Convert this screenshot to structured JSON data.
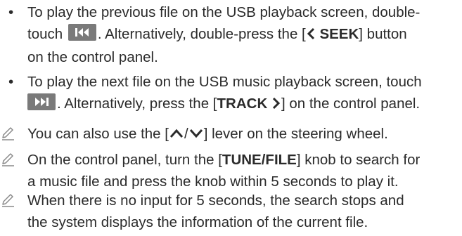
{
  "bullets": [
    {
      "part1": "To play the previous file on the USB playback screen, double-",
      "part2_before_icon": "touch",
      "icon": "skip-previous-icon",
      "part2_after_icon": ". Alternatively, double-press the [",
      "button_label": "SEEK",
      "part2_end": "] button",
      "part3": "on the control panel."
    },
    {
      "part1": "To play the next file on the USB music playback screen, touch",
      "icon": "skip-next-icon",
      "part2_after_icon": ". Alternatively, press the [",
      "button_label": "TRACK",
      "part2_end": "] on the control panel."
    }
  ],
  "notes": [
    {
      "icon": "pencil-note-icon",
      "before": "You can also use the [",
      "after": "] lever on the steering wheel."
    },
    {
      "icon": "pencil-note-icon",
      "line1_before": "On the control panel, turn the [",
      "knob_label": "TUNE/FILE",
      "line1_after": "] knob to search for",
      "line2": "a music file and press the knob within 5 seconds to play it."
    },
    {
      "icon": "pencil-note-icon",
      "line1": "When there is no input for 5 seconds, the search stops and",
      "line2": "the system displays the information of the current file."
    }
  ],
  "colors": {
    "text": "#2b2b2b",
    "icon_bg": "#7a7a7a",
    "note_icon": "#8a8a8a"
  }
}
